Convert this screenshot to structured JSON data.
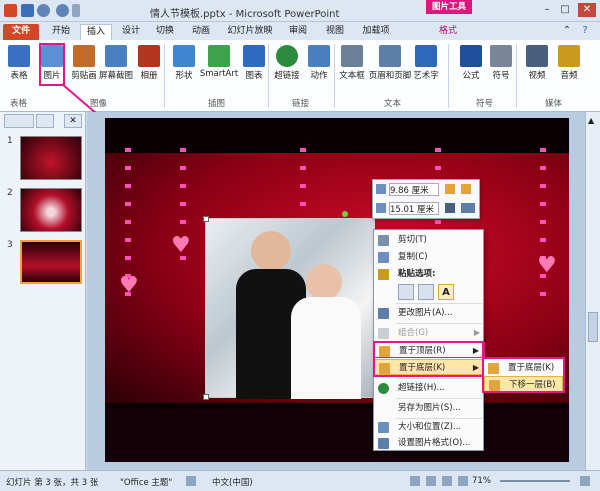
{
  "titlebar": {
    "title": "情人节模板.pptx - Microsoft PowerPoint",
    "context_tab": "图片工具"
  },
  "tabs": [
    "文件",
    "开始",
    "插入",
    "设计",
    "切换",
    "动画",
    "幻灯片放映",
    "审阅",
    "视图",
    "加载项",
    "格式"
  ],
  "ribbon": {
    "buttons": [
      {
        "label": "表格",
        "icon": "table-icon",
        "color": "#3a6fc4"
      },
      {
        "label": "图片",
        "icon": "picture-icon",
        "color": "#5b8fd6"
      },
      {
        "label": "剪贴画",
        "icon": "clipart-icon",
        "color": "#c26c2b"
      },
      {
        "label": "屏幕截图",
        "icon": "screenshot-icon",
        "color": "#4b7fc0"
      },
      {
        "label": "相册",
        "icon": "album-icon",
        "color": "#b5341f"
      },
      {
        "label": "形状",
        "icon": "shapes-icon",
        "color": "#3f86cf"
      },
      {
        "label": "SmartArt",
        "icon": "smartart-icon",
        "color": "#3da34a"
      },
      {
        "label": "图表",
        "icon": "chart-icon",
        "color": "#2f6bbf"
      },
      {
        "label": "超链接",
        "icon": "hyperlink-icon",
        "color": "#2c8a3d"
      },
      {
        "label": "动作",
        "icon": "action-icon",
        "color": "#4a7fbf"
      },
      {
        "label": "文本框",
        "icon": "textbox-icon",
        "color": "#6b7f96"
      },
      {
        "label": "页眉和页脚",
        "icon": "header-footer-icon",
        "color": "#5d7ea8"
      },
      {
        "label": "艺术字",
        "icon": "wordart-icon",
        "color": "#2f68b8"
      },
      {
        "label": "公式",
        "icon": "pi-icon",
        "color": "#1f4f9a"
      },
      {
        "label": "符号",
        "icon": "omega-icon",
        "color": "#7a8698"
      },
      {
        "label": "视频",
        "icon": "video-icon",
        "color": "#4a5f7c"
      },
      {
        "label": "音频",
        "icon": "audio-icon",
        "color": "#c99a1c"
      }
    ],
    "groups": [
      "表格",
      "图像",
      "插图",
      "链接",
      "文本",
      "符号",
      "媒体"
    ]
  },
  "leftpane": {
    "tabs": [
      "",
      "",
      ""
    ],
    "slide_numbers": [
      "1",
      "2",
      "3"
    ]
  },
  "minibar": {
    "height_value": "9.86 厘米",
    "width_value": "15.01 厘米"
  },
  "context_menu": {
    "items": [
      {
        "label": "剪切(T)",
        "icon": "scissors-icon",
        "disabled": false
      },
      {
        "label": "复制(C)",
        "icon": "copy-icon",
        "disabled": false
      },
      {
        "label": "粘贴选项:",
        "icon": "paste-icon",
        "disabled": false
      },
      {
        "label": "更改图片(A)...",
        "icon": "change-picture-icon",
        "disabled": false
      },
      {
        "label": "组合(G)",
        "icon": "group-icon",
        "disabled": true
      },
      {
        "label": "置于顶层(R)",
        "icon": "bring-front-icon",
        "disabled": false
      },
      {
        "label": "置于底层(K)",
        "icon": "send-back-icon",
        "disabled": false
      },
      {
        "label": "超链接(H)...",
        "icon": "hyperlink-icon",
        "disabled": false
      },
      {
        "label": "另存为图片(S)...",
        "icon": "",
        "disabled": false
      },
      {
        "label": "大小和位置(Z)...",
        "icon": "size-icon",
        "disabled": false
      },
      {
        "label": "设置图片格式(O)...",
        "icon": "format-picture-icon",
        "disabled": false
      }
    ],
    "paste_option": "A"
  },
  "submenu": {
    "items": [
      "置于底层(K)",
      "下移一层(B)"
    ]
  },
  "statusbar": {
    "slide_info": "幻灯片 第 3 张，共 3 张",
    "theme": "\"Office 主题\"",
    "language": "中文(中国)",
    "zoom": "71%"
  },
  "colors": {
    "highlight": "#e0168c",
    "slide_red": "#b0001a",
    "menu_hover": "#fde6a7"
  }
}
